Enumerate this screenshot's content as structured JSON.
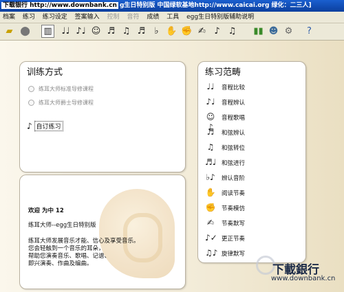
{
  "title": {
    "watermark": "下载银行 http://www.downbank.cn",
    "text": "g生日特别版  中国绿软基地http://www.caicai.org  绿化：二三人]"
  },
  "menu": [
    "档案",
    "练习",
    "练习设定",
    "签案输入",
    "控制",
    "音符",
    "成绩",
    "工具",
    "egg生日特别版辅助说明"
  ],
  "toolbar": {
    "icons": [
      "open-folder-icon",
      "record-icon",
      "piano-icon",
      "interval-compare-icon",
      "interval-identify-icon",
      "interval-sing-icon",
      "chord-identify-icon",
      "chord-inversion-icon",
      "chord-progression-icon",
      "scale-identify-icon",
      "rhythm-read-icon",
      "rhythm-imitate-icon",
      "rhythm-dictation-icon",
      "rhythm-correct-icon",
      "melody-dictation-icon",
      "score-chart-icon",
      "student-icon",
      "settings-icon",
      "help-icon"
    ]
  },
  "training_mode": {
    "title": "训练方式",
    "options": [
      "练耳大师标准导修课程",
      "练耳大师爵士导修课程"
    ],
    "custom_button": "自订练习"
  },
  "info": {
    "welcome": "欢迎 为中 12",
    "product": "练耳大师--egg生日特别版",
    "line1": "练耳大师发展音乐才能、信心及享受音乐。",
    "line2": "您会轻触到一个音乐的耳朵，",
    "line3": "帮助您演奏音乐、歌唱、记谱、",
    "line4": "即兴演奏、作曲及编曲。"
  },
  "practice_scope": {
    "title": "练习范畴",
    "items": [
      {
        "label": "音程比较",
        "icon": "interval-compare-icon",
        "glyph": "♩♩"
      },
      {
        "label": "音程辨认",
        "icon": "interval-identify-icon",
        "glyph": "♪♩"
      },
      {
        "label": "音程歌唱",
        "icon": "singing-person-icon",
        "glyph": "☺♪"
      },
      {
        "label": "和弦辨认",
        "icon": "chord-identify-icon",
        "glyph": "♬"
      },
      {
        "label": "和弦转位",
        "icon": "chord-inversion-icon",
        "glyph": "♫"
      },
      {
        "label": "和弦进行",
        "icon": "chord-progression-icon",
        "glyph": "♬♩"
      },
      {
        "label": "辨认音阶",
        "icon": "scale-icon",
        "glyph": "♭♪"
      },
      {
        "label": "阅读节奏",
        "icon": "rhythm-read-icon",
        "glyph": "✋"
      },
      {
        "label": "节奏模仿",
        "icon": "rhythm-imitate-icon",
        "glyph": "✊"
      },
      {
        "label": "节奏默写",
        "icon": "rhythm-dictation-icon",
        "glyph": "✍"
      },
      {
        "label": "更正节奏",
        "icon": "rhythm-correct-icon",
        "glyph": "♪✓"
      },
      {
        "label": "旋律默写",
        "icon": "melody-dictation-icon",
        "glyph": "♫♪"
      }
    ]
  },
  "logo": {
    "big": "下載銀行",
    "small": "www.downbank.cn"
  }
}
